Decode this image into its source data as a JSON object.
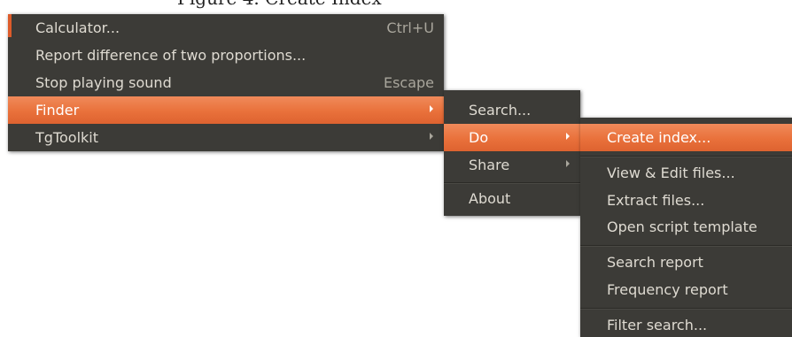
{
  "caption": "Figure 4.    Create Index",
  "menu_main": {
    "items": [
      {
        "label": "Calculator...",
        "shortcut": "Ctrl+U"
      },
      {
        "label": "Report difference of two proportions..."
      },
      {
        "label": "Stop playing sound",
        "shortcut": "Escape"
      },
      {
        "label": "Finder"
      },
      {
        "label": "TgToolkit"
      }
    ]
  },
  "menu_finder": {
    "items": [
      {
        "label": "Search..."
      },
      {
        "label": "Do"
      },
      {
        "label": "Share"
      },
      {
        "label": "About"
      }
    ]
  },
  "menu_do": {
    "items": [
      {
        "label": "Create index..."
      },
      {
        "label": "View & Edit files..."
      },
      {
        "label": "Extract files..."
      },
      {
        "label": "Open script template"
      },
      {
        "label": "Search report"
      },
      {
        "label": "Frequency report"
      },
      {
        "label": "Filter search..."
      }
    ]
  },
  "colors": {
    "menu_bg": "#3c3b37",
    "menu_text": "#dfdbd2",
    "highlight": "#e9713b",
    "shortcut_text": "#a9a69c"
  }
}
